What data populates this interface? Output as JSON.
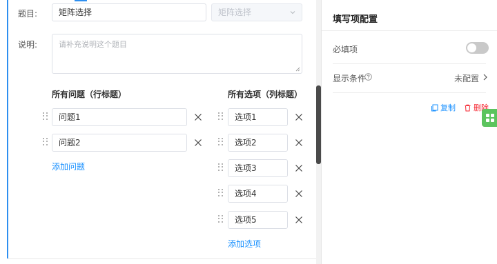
{
  "editor": {
    "title_label": "题目:",
    "title_value": "矩阵选择",
    "type_select": "矩阵选择",
    "desc_label": "说明:",
    "desc_placeholder": "请补充说明这个题目",
    "rows_header": "所有问题（行标题）",
    "cols_header": "所有选项（列标题）",
    "rows": [
      "问题1",
      "问题2"
    ],
    "cols": [
      "选项1",
      "选项2",
      "选项3",
      "选项4",
      "选项5"
    ],
    "add_row": "添加问题",
    "add_col": "添加选项"
  },
  "config": {
    "title": "填写项配置",
    "required_label": "必填项",
    "required_on": false,
    "condition_label": "显示条件",
    "condition_value": "未配置",
    "copy_label": "复制",
    "delete_label": "删除"
  },
  "colors": {
    "accent": "#2e8ff0",
    "link": "#1890ff",
    "danger": "#f5222d",
    "green": "#5cc45e"
  }
}
